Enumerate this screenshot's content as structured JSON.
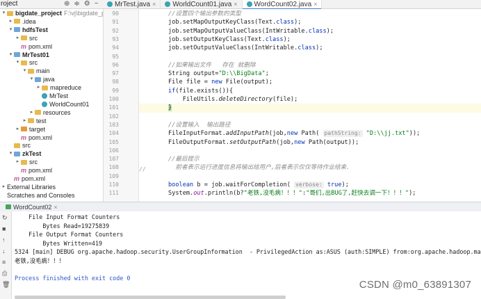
{
  "topbar": {
    "project_dropdown": "roject",
    "icons": [
      "target-icon",
      "collapse-icon",
      "settings-icon",
      "minimize-icon"
    ]
  },
  "tabs": [
    {
      "label": "MrTest.java",
      "active": false
    },
    {
      "label": "WorldCount01.java",
      "active": false
    },
    {
      "label": "WordCount02.java",
      "active": true
    }
  ],
  "project_tree": [
    {
      "label": "bigdate_project",
      "extra": "F:\\vj\\bigdate_project",
      "indent": 0,
      "arrow": "▾",
      "icon": "folder",
      "bold": true
    },
    {
      "label": ".idea",
      "indent": 1,
      "arrow": "▸",
      "icon": "folder"
    },
    {
      "label": "hdfsTest",
      "indent": 1,
      "arrow": "▾",
      "icon": "folder-blue",
      "bold": true
    },
    {
      "label": "src",
      "indent": 2,
      "arrow": "▸",
      "icon": "folder"
    },
    {
      "label": "pom.xml",
      "indent": 2,
      "arrow": "",
      "icon": "m"
    },
    {
      "label": "MrTest01",
      "indent": 1,
      "arrow": "▾",
      "icon": "folder-blue",
      "bold": true
    },
    {
      "label": "src",
      "indent": 2,
      "arrow": "▾",
      "icon": "folder"
    },
    {
      "label": "main",
      "indent": 3,
      "arrow": "▾",
      "icon": "folder"
    },
    {
      "label": "java",
      "indent": 4,
      "arrow": "▾",
      "icon": "folder-blue"
    },
    {
      "label": "mapreduce",
      "indent": 5,
      "arrow": "▸",
      "icon": "folder"
    },
    {
      "label": "MrTest",
      "indent": 5,
      "arrow": "",
      "icon": "class"
    },
    {
      "label": "WorldCount01",
      "indent": 5,
      "arrow": "",
      "icon": "class"
    },
    {
      "label": "resources",
      "indent": 4,
      "arrow": "▸",
      "icon": "folder"
    },
    {
      "label": "test",
      "indent": 3,
      "arrow": "▸",
      "icon": "folder"
    },
    {
      "label": "target",
      "indent": 2,
      "arrow": "▸",
      "icon": "folder-orange"
    },
    {
      "label": "pom.xml",
      "indent": 2,
      "arrow": "",
      "icon": "m"
    },
    {
      "label": "src",
      "indent": 1,
      "arrow": "",
      "icon": "folder"
    },
    {
      "label": "zkTest",
      "indent": 1,
      "arrow": "▾",
      "icon": "folder-blue",
      "bold": true
    },
    {
      "label": "src",
      "indent": 2,
      "arrow": "▸",
      "icon": "folder"
    },
    {
      "label": "pom.xml",
      "indent": 2,
      "arrow": "",
      "icon": "m"
    },
    {
      "label": "pom.xml",
      "indent": 1,
      "arrow": "",
      "icon": "m"
    },
    {
      "label": "External Libraries",
      "indent": 0,
      "arrow": "▸",
      "icon": "none"
    },
    {
      "label": "Scratches and Consoles",
      "indent": 0,
      "arrow": "",
      "icon": "none"
    }
  ],
  "line_numbers": [
    "90",
    "91",
    "92",
    "93",
    "94",
    "95",
    "96",
    "97",
    "98",
    "99",
    "100",
    "101",
    "102",
    "103",
    "104",
    "105",
    "106",
    "107",
    "108",
    "109",
    "110",
    "111"
  ],
  "code_lines": [
    {
      "segs": [
        {
          "t": "//设置四个输出参数的类型",
          "c": "cm"
        }
      ]
    },
    {
      "segs": [
        {
          "t": "job.setMapOutputKeyClass(Text."
        },
        {
          "t": "class",
          "c": "kw"
        },
        {
          "t": ");"
        }
      ]
    },
    {
      "segs": [
        {
          "t": "job.setMapOutputValueClass(IntWritable."
        },
        {
          "t": "class",
          "c": "kw"
        },
        {
          "t": ");"
        }
      ]
    },
    {
      "segs": [
        {
          "t": "job.setOutputKeyClass(Text."
        },
        {
          "t": "class",
          "c": "kw"
        },
        {
          "t": ");"
        }
      ]
    },
    {
      "segs": [
        {
          "t": "job.setOutputValueClass(IntWritable."
        },
        {
          "t": "class",
          "c": "kw"
        },
        {
          "t": ");"
        }
      ]
    },
    {
      "segs": [
        {
          "t": ""
        }
      ]
    },
    {
      "segs": [
        {
          "t": "//如果输出文件   存在 就删除",
          "c": "cm"
        }
      ]
    },
    {
      "segs": [
        {
          "t": "String output="
        },
        {
          "t": "\"D:\\\\BigData\"",
          "c": "str"
        },
        {
          "t": ";"
        }
      ]
    },
    {
      "segs": [
        {
          "t": "File file = "
        },
        {
          "t": "new",
          "c": "kw"
        },
        {
          "t": " File(output);"
        }
      ]
    },
    {
      "segs": [
        {
          "t": "if",
          "c": "kw"
        },
        {
          "t": "(file.exists()){"
        }
      ]
    },
    {
      "segs": [
        {
          "t": "    FileUtils."
        },
        {
          "t": "deleteDirectory",
          "c": "it"
        },
        {
          "t": "(file);"
        }
      ]
    },
    {
      "segs": [
        {
          "t": "}",
          "c": "brace"
        }
      ],
      "hl": true
    },
    {
      "segs": [
        {
          "t": ""
        }
      ]
    },
    {
      "segs": [
        {
          "t": "//设置输入  输出路径",
          "c": "cm"
        }
      ]
    },
    {
      "segs": [
        {
          "t": "FileInputFormat."
        },
        {
          "t": "addInputPath",
          "c": "it"
        },
        {
          "t": "(job,"
        },
        {
          "t": "new",
          "c": "kw"
        },
        {
          "t": " Path( "
        },
        {
          "t": "pathString:",
          "c": "hint"
        },
        {
          "t": " "
        },
        {
          "t": "\"D:\\\\jj.txt\"",
          "c": "str"
        },
        {
          "t": "));"
        }
      ]
    },
    {
      "segs": [
        {
          "t": "FileOutputFormat."
        },
        {
          "t": "setOutputPath",
          "c": "it"
        },
        {
          "t": "(job,"
        },
        {
          "t": "new",
          "c": "kw"
        },
        {
          "t": " Path(output));"
        }
      ]
    },
    {
      "segs": [
        {
          "t": ""
        }
      ]
    },
    {
      "segs": [
        {
          "t": "//最后提示",
          "c": "cm"
        }
      ]
    },
    {
      "segs": [
        {
          "t": "  前者表示运行进度信息将输出给用户,后者表示仅仅等待作业结束.",
          "c": "cm"
        }
      ]
    },
    {
      "segs": [
        {
          "t": ""
        }
      ]
    },
    {
      "segs": [
        {
          "t": "boolean",
          "c": "kw"
        },
        {
          "t": " b = job.waitForCompletion( "
        },
        {
          "t": "verbose:",
          "c": "hint"
        },
        {
          "t": " "
        },
        {
          "t": "true",
          "c": "kw"
        },
        {
          "t": ");"
        }
      ]
    },
    {
      "segs": [
        {
          "t": "System."
        },
        {
          "t": "out",
          "c": "fld"
        },
        {
          "t": ".println(b?"
        },
        {
          "t": "\"老铁,没毛病！！！\"",
          "c": "str"
        },
        {
          "t": ":"
        },
        {
          "t": "\"哥们,出BUG了,赶快去调一下！！！\"",
          "c": "str"
        },
        {
          "t": ");"
        }
      ]
    }
  ],
  "side_marker": "//",
  "run_panel": {
    "tab_label": "WordCount02",
    "tool_icons": [
      "rerun-icon",
      "stop-icon",
      "scroll-up-icon",
      "scroll-down-icon",
      "wrap-icon",
      "print-icon",
      "delete-icon"
    ]
  },
  "console_lines": [
    {
      "t": "    File Input Format Counters"
    },
    {
      "t": "        Bytes Read=19275839"
    },
    {
      "t": "    File Output Format Counters"
    },
    {
      "t": "        Bytes Written=419"
    },
    {
      "t": "5324 [main] DEBUG org.apache.hadoop.security.UserGroupInformation  - PrivilegedAction as:ASUS (auth:SIMPLE) from:org.apache.hadoop.mapreduce.Job.upd"
    },
    {
      "t": "老铁,没毛病！！！"
    },
    {
      "t": ""
    },
    {
      "t": "Process finished with exit code 0",
      "c": "link"
    }
  ],
  "watermark": "CSDN @m0_63891307"
}
